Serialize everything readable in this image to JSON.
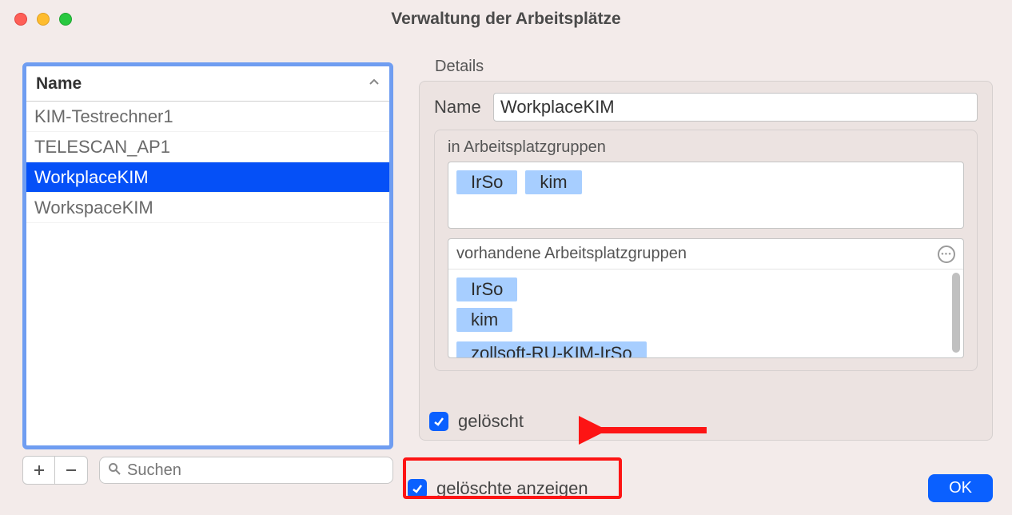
{
  "window": {
    "title": "Verwaltung der Arbeitsplätze"
  },
  "list": {
    "header": "Name",
    "items": [
      {
        "label": "KIM-Testrechner1",
        "selected": false
      },
      {
        "label": "TELESCAN_AP1",
        "selected": false
      },
      {
        "label": "WorkplaceKIM",
        "selected": true
      },
      {
        "label": "WorkspaceKIM",
        "selected": false
      }
    ]
  },
  "search": {
    "placeholder": "Suchen"
  },
  "details": {
    "section_label": "Details",
    "name_label": "Name",
    "name_value": "WorkplaceKIM",
    "in_groups_label": "in Arbeitsplatzgruppen",
    "in_groups": [
      "IrSo",
      "kim"
    ],
    "available_label": "vorhandene Arbeitsplatzgruppen",
    "available_groups": [
      "IrSo",
      "kim",
      "zollsoft-RU-KIM-IrSo"
    ],
    "deleted_label": "gelöscht",
    "deleted_checked": true
  },
  "footer": {
    "show_deleted_label": "gelöschte anzeigen",
    "show_deleted_checked": true,
    "ok_label": "OK"
  }
}
